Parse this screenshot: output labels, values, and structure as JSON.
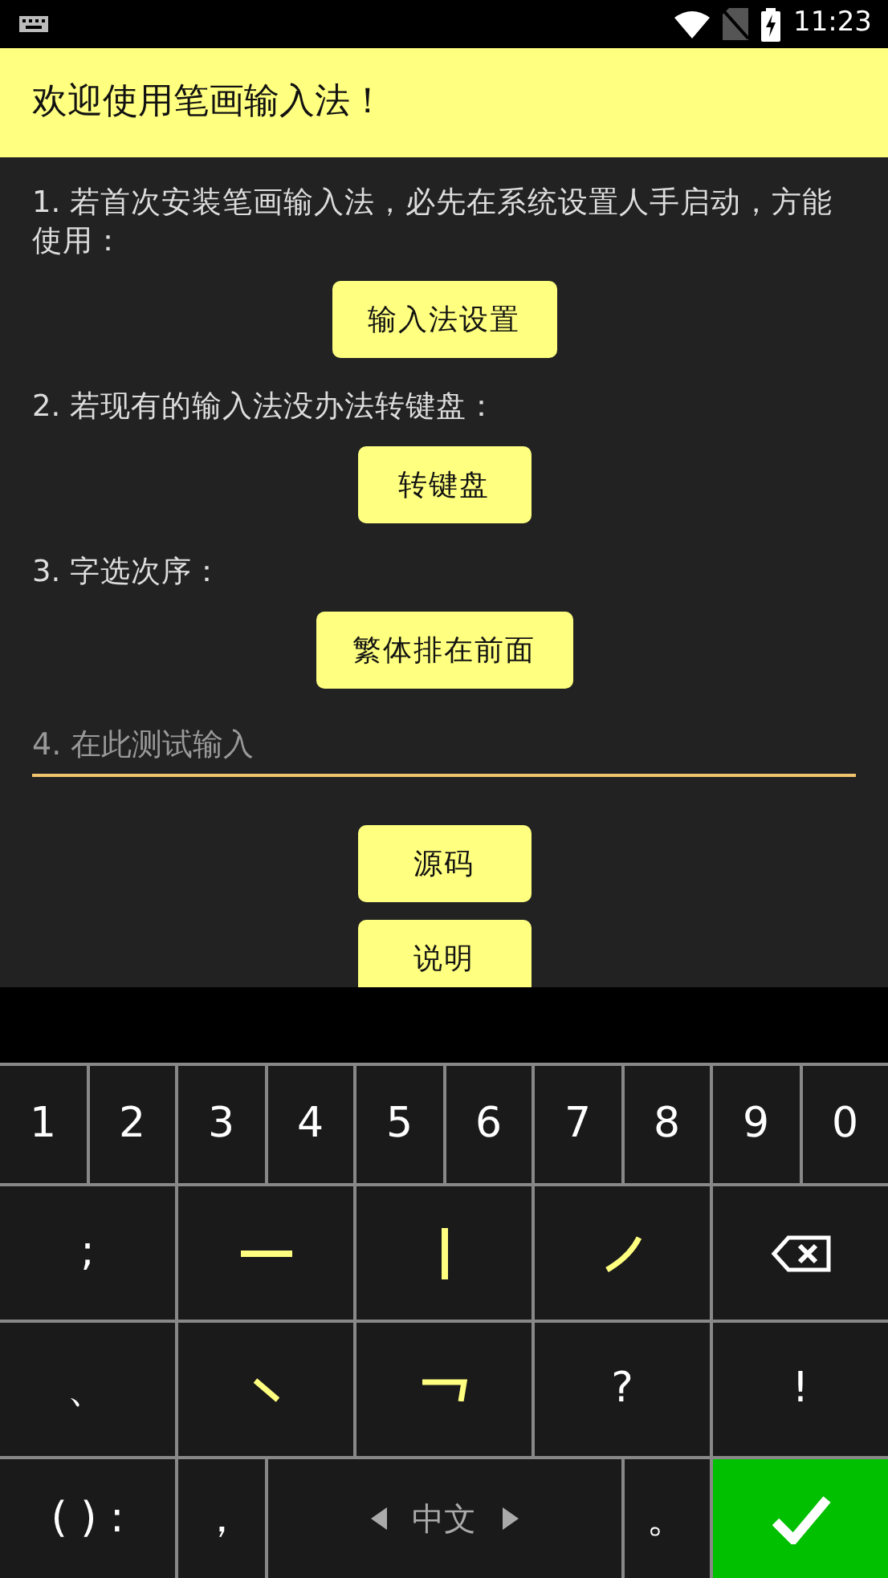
{
  "status_bar": {
    "time": "11:23"
  },
  "header": {
    "title": "欢迎使用笔画输入法！"
  },
  "sections": [
    {
      "text": "1. 若首次安装笔画输入法，必先在系统设置人手启动，方能使用：",
      "button": "输入法设置"
    },
    {
      "text": "2. 若现有的输入法没办法转键盘：",
      "button": "转键盘"
    },
    {
      "text": "3. 字选次序：",
      "button": "繁体排在前面"
    }
  ],
  "test_input": {
    "placeholder": "4. 在此测试输入",
    "focused": true
  },
  "buttons": [
    "源码",
    "说明"
  ],
  "keyboard": {
    "number_keys": [
      {
        "kind": "char",
        "label": "1"
      },
      {
        "kind": "char",
        "label": "2"
      },
      {
        "kind": "char",
        "label": "3"
      },
      {
        "kind": "char",
        "label": "4"
      },
      {
        "kind": "char",
        "label": "5"
      },
      {
        "kind": "char",
        "label": "6"
      },
      {
        "kind": "char",
        "label": "7"
      },
      {
        "kind": "char",
        "label": "8"
      },
      {
        "kind": "char",
        "label": "9"
      },
      {
        "kind": "char",
        "label": "0"
      }
    ],
    "stroke_keys": [
      {
        "kind": "char",
        "label": ";"
      },
      {
        "kind": "horizontal"
      },
      {
        "kind": "vertical"
      },
      {
        "kind": "leftfall"
      },
      {
        "kind": "backspace"
      }
    ],
    "symbol_keys": [
      {
        "kind": "char",
        "label": "、"
      },
      {
        "kind": "dot"
      },
      {
        "kind": "turn"
      },
      {
        "kind": "char",
        "label": "?"
      },
      {
        "kind": "char",
        "label": "!"
      }
    ],
    "bottom_keys": [
      {
        "kind": "char",
        "label": "( ) :"
      },
      {
        "kind": "char",
        "label": "，"
      },
      {
        "kind": "language",
        "label": "中文"
      },
      {
        "kind": "char",
        "label": "。"
      },
      {
        "kind": "enter"
      }
    ]
  }
}
